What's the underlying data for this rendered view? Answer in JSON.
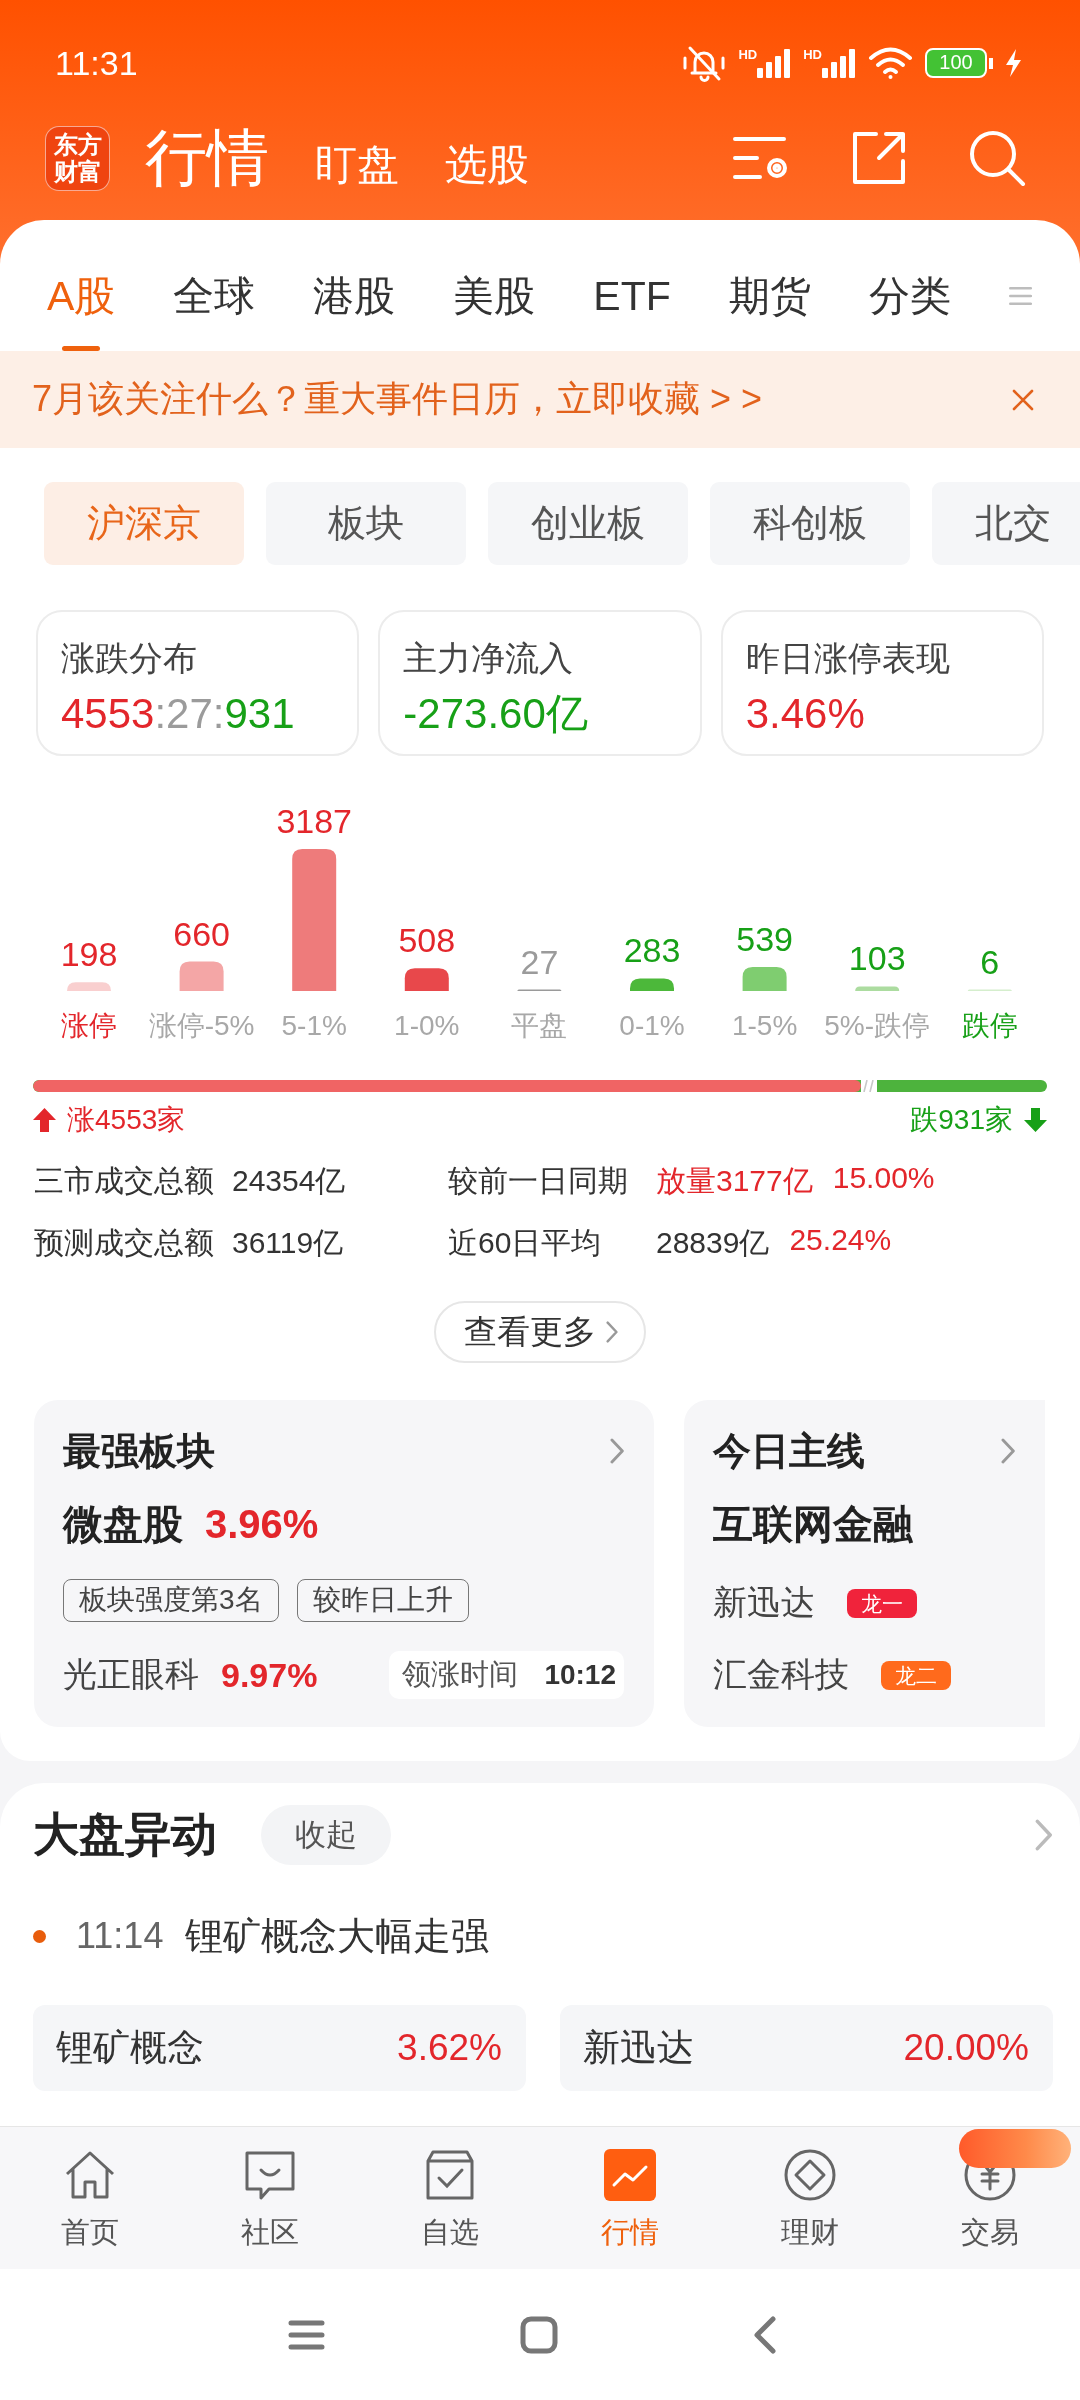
{
  "status_bar": {
    "time": "11:31",
    "network_types": [
      "HD",
      "HD"
    ],
    "battery": "100"
  },
  "header": {
    "logo": "东方财富",
    "title": "行情",
    "links": [
      "盯盘",
      "选股"
    ]
  },
  "market_tabs": [
    {
      "label": "A股",
      "selected": true
    },
    {
      "label": "全球",
      "selected": false
    },
    {
      "label": "港股",
      "selected": false
    },
    {
      "label": "美股",
      "selected": false
    },
    {
      "label": "ETF",
      "selected": false
    },
    {
      "label": "期货",
      "selected": false
    },
    {
      "label": "分类",
      "selected": false
    }
  ],
  "banner": {
    "text": "7月该关注什么？重大事件日历，立即收藏 > >"
  },
  "board_chips": [
    {
      "label": "沪深京",
      "selected": true
    },
    {
      "label": "板块",
      "selected": false
    },
    {
      "label": "创业板",
      "selected": false
    },
    {
      "label": "科创板",
      "selected": false
    },
    {
      "label": "北交",
      "selected": false
    }
  ],
  "stat_cards": [
    {
      "label": "涨跌分布",
      "value_parts": [
        {
          "text": "4553",
          "color": "#e3262b"
        },
        {
          "text": ":27:",
          "color": "#9b9b9b"
        },
        {
          "text": "931",
          "color": "#17a017"
        }
      ]
    },
    {
      "label": "主力净流入",
      "value_parts": [
        {
          "text": "-273.60亿",
          "color": "#17a017"
        }
      ]
    },
    {
      "label": "昨日涨停表现",
      "value_parts": [
        {
          "text": "3.46%",
          "color": "#e3262b"
        }
      ]
    }
  ],
  "distribution": {
    "chart_data": {
      "type": "bar",
      "categories": [
        "涨停",
        "涨停-5%",
        "5-1%",
        "1-0%",
        "平盘",
        "0-1%",
        "1-5%",
        "5%-跌停",
        "跌停"
      ],
      "values": [
        198,
        660,
        3187,
        508,
        27,
        283,
        539,
        103,
        6
      ],
      "data_labels": true
    },
    "bar_styles": [
      {
        "color": "#f9cfcf",
        "emphasis": true
      },
      {
        "color": "#f4a6a6",
        "emphasis": false
      },
      {
        "color": "#ee7b7b",
        "emphasis": false
      },
      {
        "color": "#e8484b",
        "emphasis": false
      },
      {
        "color": "#9a9a9a",
        "emphasis": false
      },
      {
        "color": "#4cb83a",
        "emphasis": false
      },
      {
        "color": "#7fcd70",
        "emphasis": false
      },
      {
        "color": "#acdca0",
        "emphasis": false
      },
      {
        "color": "#d5eecd",
        "emphasis": true
      }
    ],
    "value_labels": [
      {
        "color": "#e3262b"
      },
      {
        "color": "#e3262b"
      },
      {
        "color": "#e3262b"
      },
      {
        "color": "#e3262b"
      },
      {
        "color": "#9b9b9b"
      },
      {
        "color": "#17a017"
      },
      {
        "color": "#17a017"
      },
      {
        "color": "#17a017"
      },
      {
        "color": "#17a017"
      }
    ]
  },
  "breadth": {
    "level": 0.83,
    "rise_label": "涨4553家",
    "fall_label": "跌931家"
  },
  "turnover": [
    {
      "label": "三市成交总额",
      "value": "24354亿",
      "compare_label": "较前一日同期",
      "compare_value": "放量3177亿",
      "compare_highlight": true,
      "change": "15.00%"
    },
    {
      "label": "预测成交总额",
      "value": "36119亿",
      "compare_label": "近60日平均",
      "compare_value": "28839亿",
      "compare_highlight": false,
      "change": "25.24%"
    }
  ],
  "more_button": {
    "label": "查看更多"
  },
  "feature_cards": [
    {
      "kind": "sector",
      "title": "最强板块",
      "name": "微盘股",
      "change": "3.96%",
      "tags": [
        "板块强度第3名",
        "较昨日上升"
      ],
      "leader": "光正眼科",
      "leader_change": "9.97%",
      "time_label": "领涨时间",
      "time": "10:12"
    },
    {
      "kind": "theme",
      "title": "今日主线",
      "name": "互联网金融",
      "stocks": [
        {
          "name": "新迅达",
          "badge": "龙一",
          "color": "#f0233b"
        },
        {
          "name": "汇金科技",
          "badge": "龙二",
          "color": "#ff6a1c"
        }
      ]
    }
  ],
  "market_moves": {
    "title": "大盘异动",
    "toggle": "收起",
    "events": [
      {
        "time": "11:14",
        "text": "锂矿概念大幅走强"
      }
    ],
    "movers": [
      {
        "name": "锂矿概念",
        "change": "3.62%"
      },
      {
        "name": "新迅达",
        "change": "20.00%"
      }
    ]
  },
  "bottom_nav": [
    {
      "label": "首页",
      "selected": false
    },
    {
      "label": "社区",
      "selected": false
    },
    {
      "label": "自选",
      "selected": false
    },
    {
      "label": "行情",
      "selected": true
    },
    {
      "label": "理财",
      "selected": false
    },
    {
      "label": "交易",
      "selected": false
    }
  ]
}
